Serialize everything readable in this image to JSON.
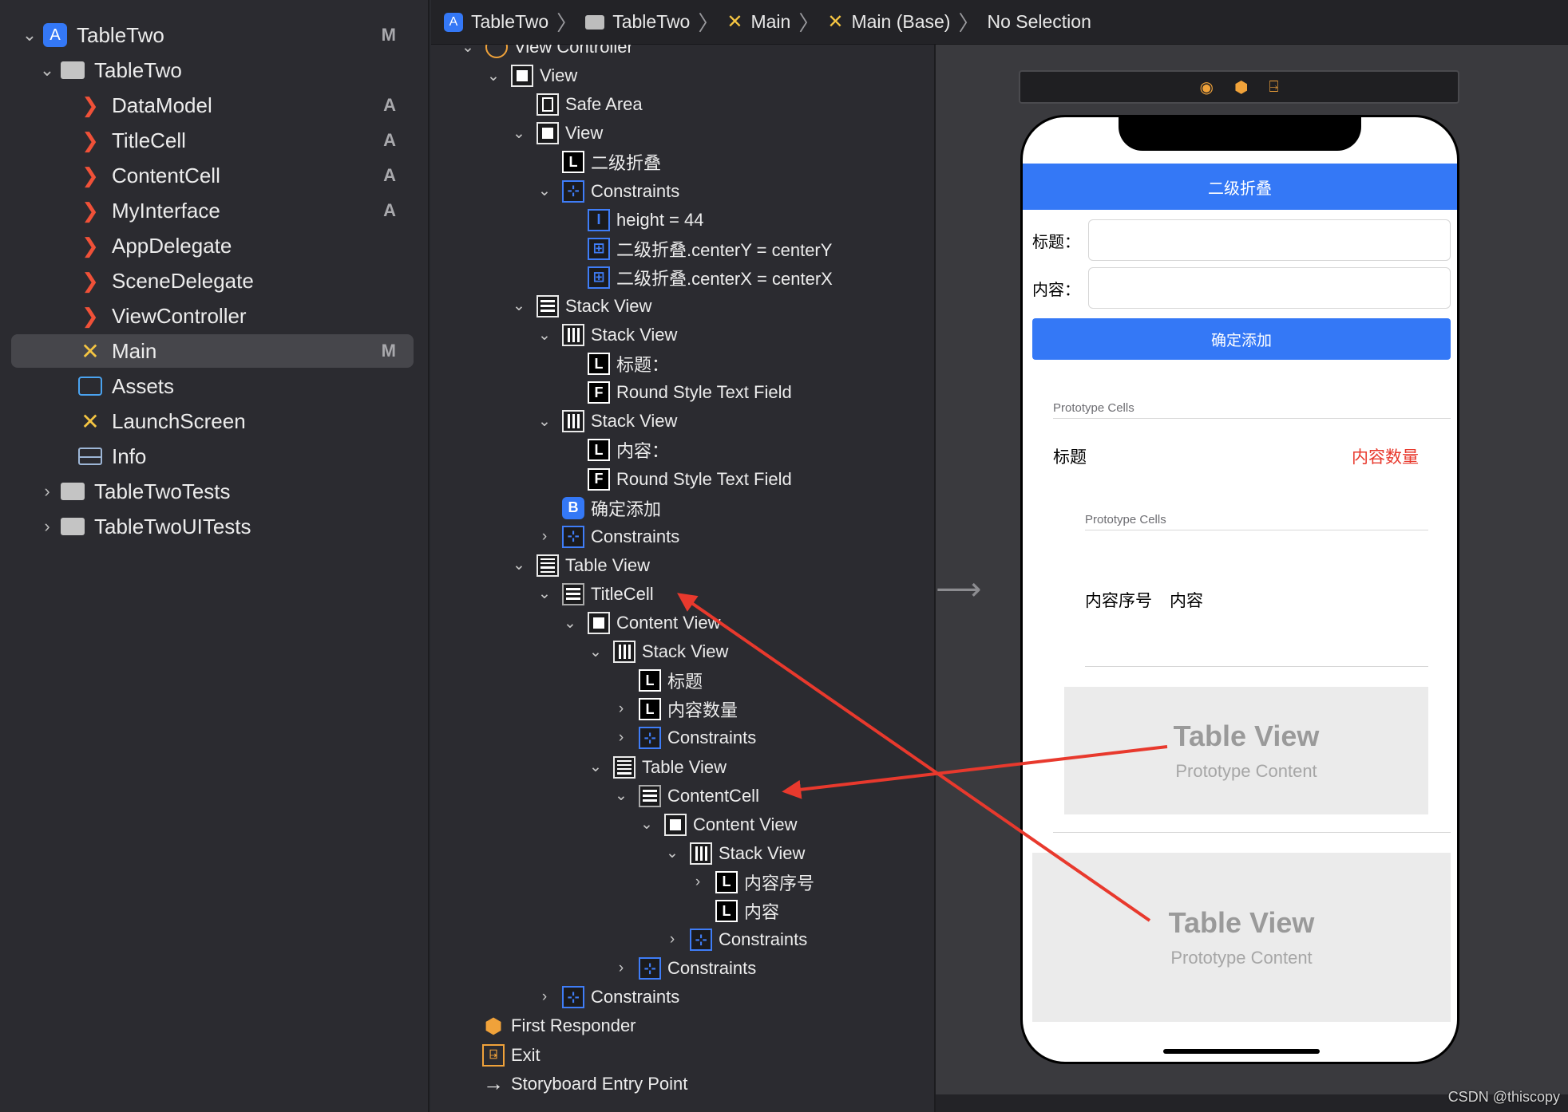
{
  "navigator": {
    "items": [
      {
        "label": "TableTwo",
        "badge": "M",
        "icon": "xcode-project-icon",
        "chevron": "⌄"
      },
      {
        "label": "TableTwo",
        "badge": "",
        "icon": "folder-icon",
        "chevron": "⌄"
      },
      {
        "label": "DataModel",
        "badge": "A",
        "icon": "swift-file-icon",
        "chevron": ""
      },
      {
        "label": "TitleCell",
        "badge": "A",
        "icon": "swift-file-icon",
        "chevron": ""
      },
      {
        "label": "ContentCell",
        "badge": "A",
        "icon": "swift-file-icon",
        "chevron": ""
      },
      {
        "label": "MyInterface",
        "badge": "A",
        "icon": "swift-file-icon",
        "chevron": ""
      },
      {
        "label": "AppDelegate",
        "badge": "",
        "icon": "swift-file-icon",
        "chevron": ""
      },
      {
        "label": "SceneDelegate",
        "badge": "",
        "icon": "swift-file-icon",
        "chevron": ""
      },
      {
        "label": "ViewController",
        "badge": "",
        "icon": "swift-file-icon",
        "chevron": ""
      },
      {
        "label": "Main",
        "badge": "M",
        "icon": "storyboard-icon",
        "chevron": ""
      },
      {
        "label": "Assets",
        "badge": "",
        "icon": "asset-catalog-icon",
        "chevron": ""
      },
      {
        "label": "LaunchScreen",
        "badge": "",
        "icon": "storyboard-icon",
        "chevron": ""
      },
      {
        "label": "Info",
        "badge": "",
        "icon": "plist-icon",
        "chevron": ""
      },
      {
        "label": "TableTwoTests",
        "badge": "",
        "icon": "folder-icon",
        "chevron": "›"
      },
      {
        "label": "TableTwoUITests",
        "badge": "",
        "icon": "folder-icon",
        "chevron": "›"
      }
    ]
  },
  "jumpbar": {
    "segments": [
      "TableTwo",
      "TableTwo",
      "Main",
      "Main (Base)",
      "No Selection"
    ],
    "separator": "〉"
  },
  "outline": {
    "rows": [
      {
        "label": "View Controller",
        "icon": "view-controller-icon",
        "chevron": "⌄"
      },
      {
        "label": "View",
        "icon": "view-icon",
        "chevron": "⌄"
      },
      {
        "label": "Safe Area",
        "icon": "safe-area-icon",
        "chevron": ""
      },
      {
        "label": "View",
        "icon": "view-icon",
        "chevron": "⌄"
      },
      {
        "label": "二级折叠",
        "icon": "label-icon",
        "chevron": ""
      },
      {
        "label": "Constraints",
        "icon": "constraints-icon",
        "chevron": "⌄"
      },
      {
        "label": "height = 44",
        "icon": "height-constraint-icon",
        "chevron": ""
      },
      {
        "label": "二级折叠.centerY = centerY",
        "icon": "center-constraint-icon",
        "chevron": ""
      },
      {
        "label": "二级折叠.centerX = centerX",
        "icon": "center-constraint-icon",
        "chevron": ""
      },
      {
        "label": "Stack View",
        "icon": "vertical-stack-icon",
        "chevron": "⌄"
      },
      {
        "label": "Stack View",
        "icon": "horizontal-stack-icon",
        "chevron": "⌄"
      },
      {
        "label": "标题：",
        "icon": "label-icon",
        "chevron": ""
      },
      {
        "label": "Round Style Text Field",
        "icon": "text-field-icon",
        "chevron": ""
      },
      {
        "label": "Stack View",
        "icon": "horizontal-stack-icon",
        "chevron": "⌄"
      },
      {
        "label": "内容：",
        "icon": "label-icon",
        "chevron": ""
      },
      {
        "label": "Round Style Text Field",
        "icon": "text-field-icon",
        "chevron": ""
      },
      {
        "label": "确定添加",
        "icon": "button-icon",
        "chevron": ""
      },
      {
        "label": "Constraints",
        "icon": "constraints-icon",
        "chevron": "›"
      },
      {
        "label": "Table View",
        "icon": "table-view-icon",
        "chevron": "⌄"
      },
      {
        "label": "TitleCell",
        "icon": "table-cell-icon",
        "chevron": "⌄"
      },
      {
        "label": "Content View",
        "icon": "view-icon",
        "chevron": "⌄"
      },
      {
        "label": "Stack View",
        "icon": "horizontal-stack-icon",
        "chevron": "⌄"
      },
      {
        "label": "标题",
        "icon": "label-icon",
        "chevron": ""
      },
      {
        "label": "内容数量",
        "icon": "label-icon",
        "chevron": "›"
      },
      {
        "label": "Constraints",
        "icon": "constraints-icon",
        "chevron": "›"
      },
      {
        "label": "Table View",
        "icon": "table-view-icon",
        "chevron": "⌄"
      },
      {
        "label": "ContentCell",
        "icon": "table-cell-icon",
        "chevron": "⌄"
      },
      {
        "label": "Content View",
        "icon": "view-icon",
        "chevron": "⌄"
      },
      {
        "label": "Stack View",
        "icon": "horizontal-stack-icon",
        "chevron": "⌄"
      },
      {
        "label": "内容序号",
        "icon": "label-icon",
        "chevron": "›"
      },
      {
        "label": "内容",
        "icon": "label-icon",
        "chevron": ""
      },
      {
        "label": "Constraints",
        "icon": "constraints-icon",
        "chevron": "›"
      },
      {
        "label": "Constraints",
        "icon": "constraints-icon",
        "chevron": "›"
      },
      {
        "label": "Constraints",
        "icon": "constraints-icon",
        "chevron": "›"
      },
      {
        "label": "First Responder",
        "icon": "first-responder-icon",
        "chevron": ""
      },
      {
        "label": "Exit",
        "icon": "exit-icon",
        "chevron": ""
      },
      {
        "label": "Storyboard Entry Point",
        "icon": "entry-point-icon",
        "chevron": ""
      }
    ]
  },
  "canvas": {
    "nav_title": "二级折叠",
    "title_label": "标题：",
    "content_label": "内容：",
    "add_button": "确定添加",
    "prototype_cells_outer": "Prototype Cells",
    "title_cell_title": "标题",
    "title_cell_count": "内容数量",
    "prototype_cells_inner": "Prototype Cells",
    "content_cell_index": "内容序号",
    "content_cell_text": "内容",
    "inner_table_title": "Table View",
    "inner_table_subtitle": "Prototype Content",
    "outer_table_title": "Table View",
    "outer_table_subtitle": "Prototype Content"
  },
  "watermark": "CSDN @thiscopy",
  "colors": {
    "accent_blue": "#3478f6",
    "annotation_red": "#e8392d",
    "swift_orange": "#f05138",
    "storyboard_yellow": "#f5c542"
  }
}
